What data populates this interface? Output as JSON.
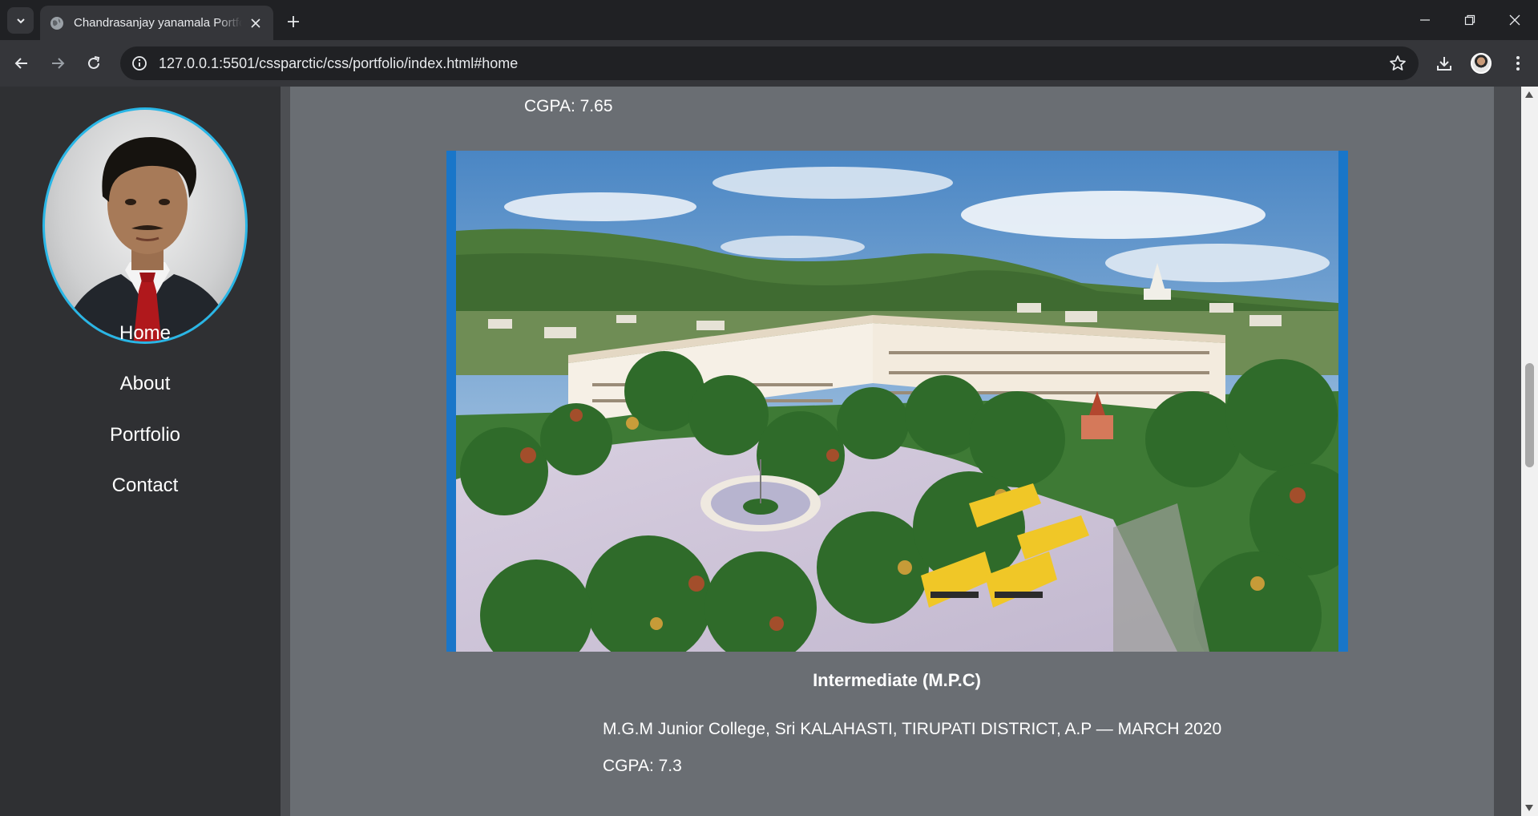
{
  "browser": {
    "tab_title": "Chandrasanjay yanamala Portfolio",
    "url": "127.0.0.1:5501/cssparctic/css/portfolio/index.html#home"
  },
  "sidebar": {
    "nav": [
      {
        "label": "Home"
      },
      {
        "label": "About"
      },
      {
        "label": "Portfolio"
      },
      {
        "label": "Contact"
      }
    ]
  },
  "main": {
    "previous_cgpa": "CGPA: 7.65",
    "education": {
      "title": "Intermediate (M.P.C)",
      "institution": "M.G.M Junior College, Sri KALAHASTI, TIRUPATI DISTRICT, A.P — MARCH 2020",
      "cgpa": "CGPA: 7.3"
    }
  },
  "colors": {
    "accent_ring": "#29b6e6",
    "photo_frame": "#1976c9",
    "content_bg": "#6a6e73",
    "sidebar_bg": "#2f3033"
  },
  "icons": [
    "tab-search-icon",
    "globe-icon",
    "close-icon",
    "plus-icon",
    "minimize-icon",
    "restore-icon",
    "window-close-icon",
    "back-arrow-icon",
    "forward-arrow-icon",
    "reload-icon",
    "info-icon",
    "star-icon",
    "download-icon",
    "profile-avatar-icon",
    "kebab-menu-icon"
  ]
}
